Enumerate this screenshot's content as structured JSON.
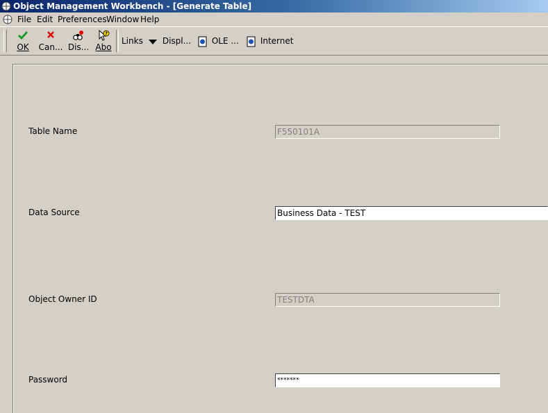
{
  "window": {
    "title": "Object Management Workbench - [Generate Table]"
  },
  "menu": {
    "items": [
      "File",
      "Edit",
      "Preferences",
      "Window",
      "Help"
    ]
  },
  "toolbar": {
    "ok": "OK",
    "cancel": "Can...",
    "display": "Dis...",
    "about": "Abo",
    "links": "Links",
    "display_menu": "Displ...",
    "ole": "OLE ...",
    "internet": "Internet"
  },
  "form": {
    "table_name": {
      "label": "Table Name",
      "value": "F550101A"
    },
    "data_source": {
      "label": "Data Source",
      "value": "Business Data - TEST"
    },
    "object_owner": {
      "label": "Object Owner ID",
      "value": "TESTDTA"
    },
    "password": {
      "label": "Password",
      "value": "*******"
    }
  },
  "colors": {
    "title_start": "#0a246a",
    "title_end": "#a6caf0",
    "face": "#d4d0c8",
    "ok_green": "#1a9a2a",
    "cancel_red": "#e00000"
  },
  "icons": [
    "app-icon",
    "check-icon",
    "x-icon",
    "binoculars-icon",
    "help-icon",
    "dropdown-arrow-icon",
    "ole-icon",
    "internet-icon"
  ]
}
